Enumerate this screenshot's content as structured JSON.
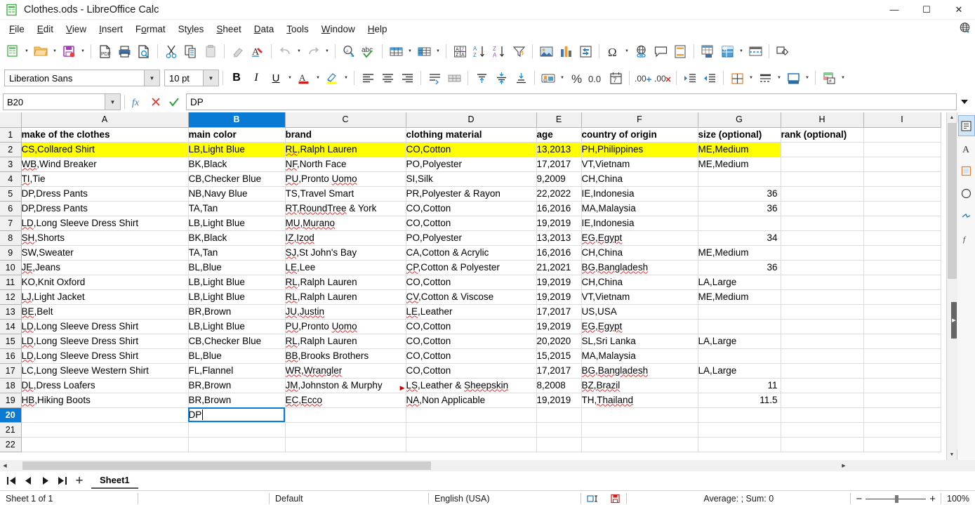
{
  "window": {
    "title": "Clothes.ods - LibreOffice Calc",
    "app_icon": "calc-document-icon",
    "minimize": "—",
    "maximize": "☐",
    "close": "✕"
  },
  "menubar": {
    "items": [
      {
        "label": "File",
        "accel": "F"
      },
      {
        "label": "Edit",
        "accel": "E"
      },
      {
        "label": "View",
        "accel": "V"
      },
      {
        "label": "Insert",
        "accel": "I"
      },
      {
        "label": "Format",
        "accel": "o"
      },
      {
        "label": "Styles",
        "accel": "y"
      },
      {
        "label": "Sheet",
        "accel": "S"
      },
      {
        "label": "Data",
        "accel": "D"
      },
      {
        "label": "Tools",
        "accel": "T"
      },
      {
        "label": "Window",
        "accel": "W"
      },
      {
        "label": "Help",
        "accel": "H"
      }
    ],
    "right_icon": "globe-icon"
  },
  "toolbar_standard": {
    "items": [
      "new-document-icon",
      "dropdown-arrow",
      "open-file-icon",
      "dropdown-arrow",
      "save-icon",
      "dropdown-arrow",
      "separator",
      "export-pdf-icon",
      "print-icon",
      "print-preview-icon",
      "separator",
      "cut-icon",
      "copy-icon",
      "paste-icon",
      "separator",
      "clone-formatting-icon",
      "clear-formatting-icon",
      "separator",
      "undo-icon",
      "dropdown-arrow",
      "redo-icon",
      "dropdown-arrow",
      "separator",
      "find-replace-icon",
      "spelling-icon",
      "separator",
      "row-icon",
      "dropdown-arrow",
      "column-icon",
      "dropdown-arrow",
      "separator",
      "sort-icon",
      "sort-ascending-icon",
      "sort-descending-icon",
      "autofilter-icon",
      "separator",
      "insert-image-icon",
      "insert-chart-icon",
      "pivot-table-icon",
      "separator",
      "special-character-icon",
      "dropdown-arrow",
      "hyperlink-icon",
      "comment-icon",
      "headers-footers-icon",
      "separator",
      "define-print-area-icon",
      "freeze-rows-columns-icon",
      "dropdown-arrow",
      "split-window-icon",
      "separator",
      "draw-functions-icon"
    ]
  },
  "toolbar_format": {
    "font_name": "Liberation Sans",
    "font_size": "10 pt",
    "bold_label": "B",
    "italic_label": "I",
    "underline_label": "U",
    "items": [
      "bold-icon",
      "italic-icon",
      "underline-icon",
      "dropdown-arrow",
      "font-color-icon",
      "dropdown-arrow",
      "highlight-color-icon",
      "dropdown-arrow",
      "separator",
      "align-left-icon",
      "align-center-icon",
      "align-right-icon",
      "separator",
      "wrap-text-icon",
      "merge-cells-icon",
      "separator",
      "align-top-icon",
      "align-center-vertical-icon",
      "align-bottom-icon",
      "separator",
      "format-currency-icon",
      "dropdown-arrow",
      "format-percent-icon",
      "format-number-icon",
      "format-date-icon",
      "separator",
      "add-decimal-icon",
      "delete-decimal-icon",
      "separator",
      "increase-indent-icon",
      "decrease-indent-icon",
      "separator",
      "borders-icon",
      "dropdown-arrow",
      "border-style-icon",
      "dropdown-arrow",
      "background-color-icon",
      "dropdown-arrow",
      "separator",
      "conditional-formatting-icon",
      "dropdown-arrow"
    ]
  },
  "formula_bar": {
    "name_box_value": "B20",
    "name_box_dropdown": "chevron-down-icon",
    "function_wizard_icon": "function-wizard-icon",
    "reject_icon": "cancel-icon",
    "accept_icon": "accept-icon",
    "input_line_value": "DP",
    "expand_icon": "expand-formula-bar-icon"
  },
  "grid": {
    "column_headers": [
      "A",
      "B",
      "C",
      "D",
      "E",
      "F",
      "G",
      "H",
      "I"
    ],
    "selected_column": "B",
    "selected_row": "20",
    "active_cell": "B20",
    "row_numbers": [
      "1",
      "2",
      "3",
      "4",
      "5",
      "6",
      "7",
      "8",
      "9",
      "10",
      "11",
      "12",
      "13",
      "14",
      "15",
      "16",
      "17",
      "18",
      "19",
      "20",
      "21",
      "22"
    ],
    "headers_row": [
      "make of the clothes",
      "main color",
      "brand",
      "clothing material",
      "age",
      "country of origin",
      "size (optional)",
      "rank (optional)",
      ""
    ],
    "rows": [
      {
        "n": "2",
        "highlight": true,
        "cells": [
          "CS,Collared Shirt",
          "LB,Light Blue",
          "RL,Ralph Lauren",
          "CO,Cotton",
          "13,2013",
          "PH,Philippines",
          "ME,Medium",
          "",
          ""
        ],
        "numeric_cols": []
      },
      {
        "n": "3",
        "highlight": false,
        "cells": [
          "WB,Wind Breaker",
          "BK,Black",
          "NF,North Face",
          "PO,Polyester",
          "17,2017",
          "VT,Vietnam",
          "ME,Medium",
          "",
          ""
        ],
        "numeric_cols": []
      },
      {
        "n": "4",
        "highlight": false,
        "cells": [
          "TI,Tie",
          "CB,Checker Blue",
          "PU,Pronto Uomo",
          "SI,Silk",
          "9,2009",
          "CH,China",
          "",
          "",
          ""
        ],
        "numeric_cols": []
      },
      {
        "n": "5",
        "highlight": false,
        "cells": [
          "DP,Dress Pants",
          "NB,Navy Blue",
          "TS,Travel Smart",
          "PR,Polyester & Rayon",
          "22,2022",
          "IE,Indonesia",
          "36",
          "",
          ""
        ],
        "numeric_cols": [
          6
        ]
      },
      {
        "n": "6",
        "highlight": false,
        "cells": [
          "DP,Dress Pants",
          "TA,Tan",
          "RT,RoundTree & York",
          "CO,Cotton",
          "16,2016",
          "MA,Malaysia",
          "36",
          "",
          ""
        ],
        "numeric_cols": [
          6
        ]
      },
      {
        "n": "7",
        "highlight": false,
        "cells": [
          "LD,Long Sleeve Dress Shirt",
          "LB,Light Blue",
          "MU,Murano",
          "CO,Cotton",
          "19,2019",
          "IE,Indonesia",
          "",
          "",
          ""
        ],
        "numeric_cols": []
      },
      {
        "n": "8",
        "highlight": false,
        "cells": [
          "SH,Shorts",
          "BK,Black",
          "IZ,Izod",
          "PO,Polyester",
          "13,2013",
          "EG,Egypt",
          "34",
          "",
          ""
        ],
        "numeric_cols": [
          6
        ]
      },
      {
        "n": "9",
        "highlight": false,
        "cells": [
          "SW,Sweater",
          "TA,Tan",
          "SJ,St John's Bay",
          "CA,Cotton & Acrylic",
          "16,2016",
          "CH,China",
          "ME,Medium",
          "",
          ""
        ],
        "numeric_cols": []
      },
      {
        "n": "10",
        "highlight": false,
        "cells": [
          "JE,Jeans",
          "BL,Blue",
          "LE,Lee",
          "CP,Cotton & Polyester",
          "21,2021",
          "BG,Bangladesh",
          "36",
          "",
          ""
        ],
        "numeric_cols": [
          6
        ]
      },
      {
        "n": "11",
        "highlight": false,
        "cells": [
          "KO,Knit Oxford",
          "LB,Light Blue",
          "RL,Ralph Lauren",
          "CO,Cotton",
          "19,2019",
          "CH,China",
          "LA,Large",
          "",
          ""
        ],
        "numeric_cols": []
      },
      {
        "n": "12",
        "highlight": false,
        "cells": [
          "LJ,Light Jacket",
          "LB,Light Blue",
          "RL,Ralph Lauren",
          "CV,Cotton & Viscose",
          "19,2019",
          "VT,Vietnam",
          "ME,Medium",
          "",
          ""
        ],
        "numeric_cols": []
      },
      {
        "n": "13",
        "highlight": false,
        "cells": [
          "BE,Belt",
          "BR,Brown",
          "JU,Justin",
          "LE,Leather",
          "17,2017",
          "US,USA",
          "",
          "",
          ""
        ],
        "numeric_cols": []
      },
      {
        "n": "14",
        "highlight": false,
        "cells": [
          "LD,Long Sleeve Dress Shirt",
          "LB,Light Blue",
          "PU,Pronto Uomo",
          "CO,Cotton",
          "19,2019",
          "EG,Egypt",
          "",
          "",
          ""
        ],
        "numeric_cols": []
      },
      {
        "n": "15",
        "highlight": false,
        "cells": [
          "LD,Long Sleeve Dress Shirt",
          "CB,Checker Blue",
          "RL,Ralph Lauren",
          "CO,Cotton",
          "20,2020",
          "SL,Sri Lanka",
          "LA,Large",
          "",
          ""
        ],
        "numeric_cols": []
      },
      {
        "n": "16",
        "highlight": false,
        "cells": [
          "LD,Long Sleeve Dress Shirt",
          "BL,Blue",
          "BB,Brooks Brothers",
          "CO,Cotton",
          "15,2015",
          "MA,Malaysia",
          "",
          "",
          ""
        ],
        "numeric_cols": []
      },
      {
        "n": "17",
        "highlight": false,
        "cells": [
          "LC,Long Sleeve Western Shirt",
          "FL,Flannel",
          "WR,Wrangler",
          "CO,Cotton",
          "17,2017",
          "BG,Bangladesh",
          "LA,Large",
          "",
          ""
        ],
        "numeric_cols": []
      },
      {
        "n": "18",
        "highlight": false,
        "cells": [
          "DL,Dress Loafers",
          "BR,Brown",
          "JM,Johnston & Murphy",
          "LS,Leather & Sheepskin",
          "8,2008",
          "BZ,Brazil",
          "11",
          "",
          ""
        ],
        "numeric_cols": [
          6
        ]
      },
      {
        "n": "19",
        "highlight": false,
        "cells": [
          "HB,Hiking Boots",
          "BR,Brown",
          "EC,Ecco",
          "NA,Non Applicable",
          "19,2019",
          "TH,Thailand",
          "11.5",
          "",
          ""
        ],
        "numeric_cols": [
          6
        ]
      },
      {
        "n": "20",
        "highlight": false,
        "cells": [
          "",
          "DP",
          "",
          "",
          "",
          "",
          "",
          "",
          ""
        ],
        "numeric_cols": [],
        "editing_col": 1
      },
      {
        "n": "21",
        "highlight": false,
        "cells": [
          "",
          "",
          "",
          "",
          "",
          "",
          "",
          "",
          ""
        ],
        "numeric_cols": []
      },
      {
        "n": "22",
        "highlight": false,
        "cells": [
          "",
          "",
          "",
          "",
          "",
          "",
          "",
          "",
          ""
        ],
        "numeric_cols": []
      }
    ],
    "highlight_color": "#ffff00",
    "selection_color": "#0a7bd4"
  },
  "sidebar": {
    "items": [
      "sidebar-settings-icon",
      "properties-icon",
      "styles-icon",
      "gallery-icon",
      "navigator-icon",
      "functions-icon"
    ],
    "hide_handle": "sidebar-hide-handle"
  },
  "sheet_tabs": {
    "first_icon": "first-sheet-icon",
    "prev_icon": "previous-sheet-icon",
    "next_icon": "next-sheet-icon",
    "last_icon": "last-sheet-icon",
    "add_label": "+",
    "tabs": [
      {
        "label": "Sheet1",
        "active": true
      }
    ]
  },
  "statusbar": {
    "sheet_count": "Sheet 1 of 1",
    "page_style": "Default",
    "language": "English (USA)",
    "insert_mode_icon": "insert-mode-icon",
    "save_state_icon": "unsaved-changes-icon",
    "selection_summary": "Average: ; Sum: 0",
    "zoom_out": "−",
    "zoom_in": "+",
    "zoom_level": "100%"
  }
}
